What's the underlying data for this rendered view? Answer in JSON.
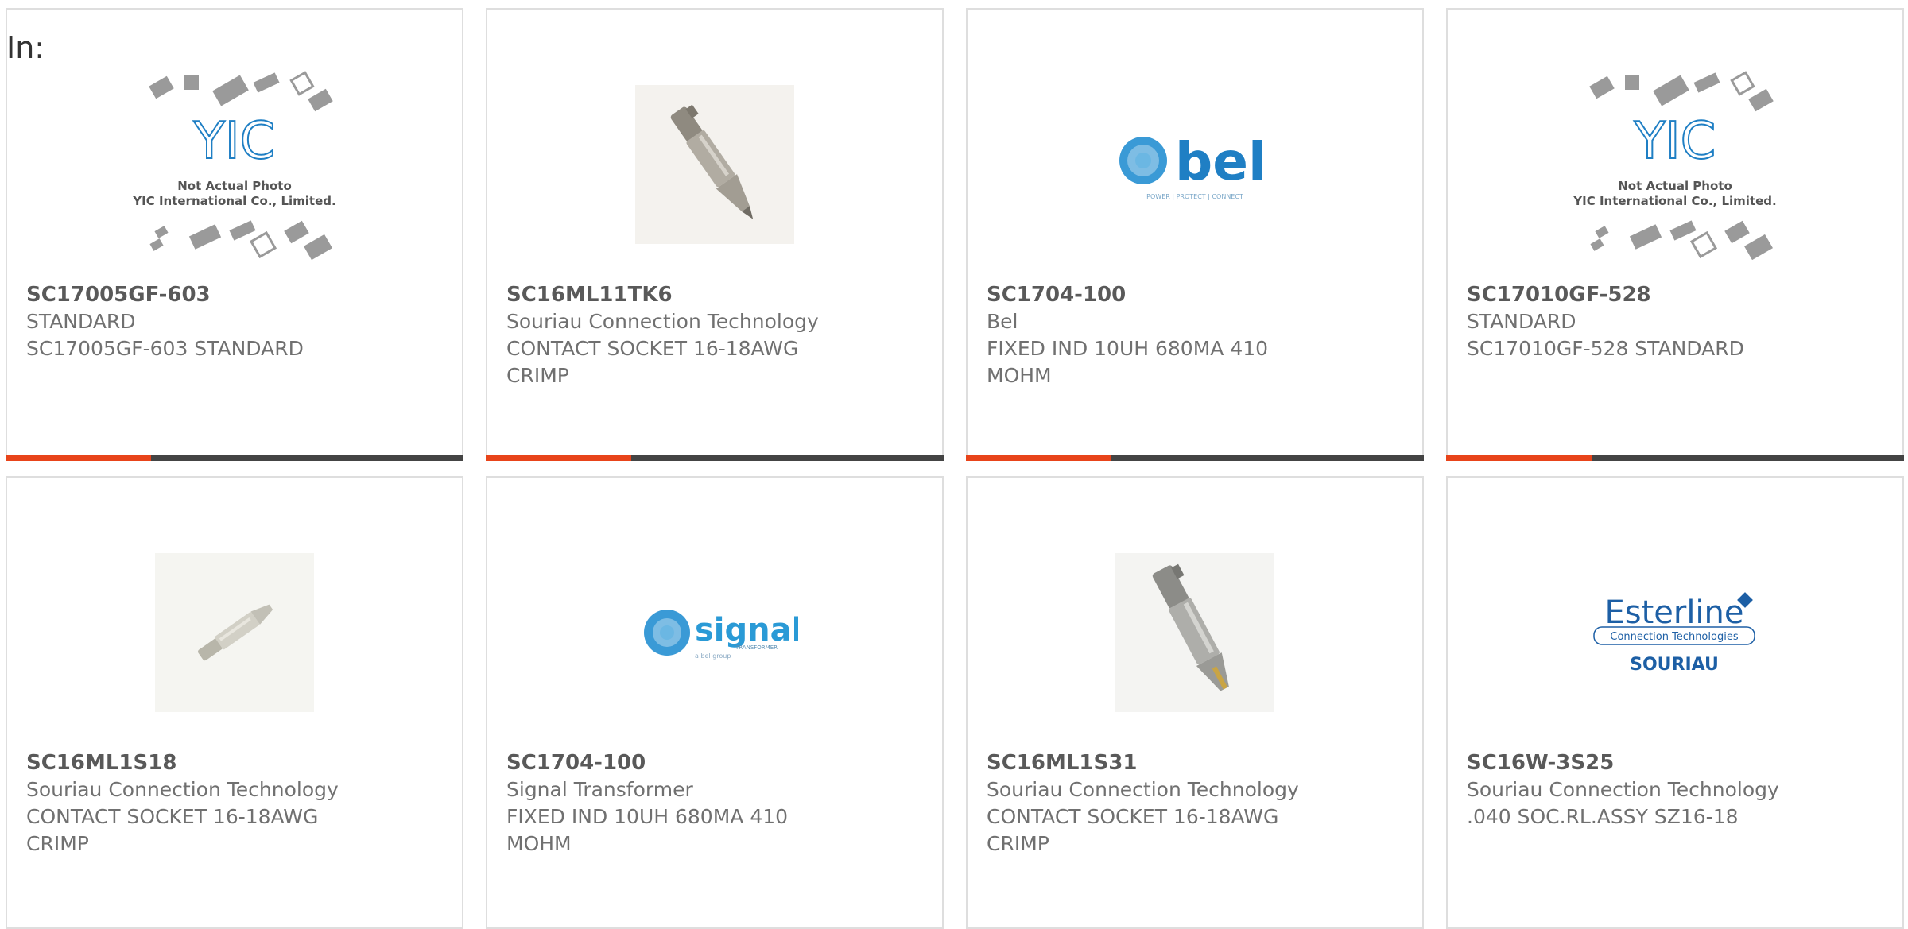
{
  "header": {
    "in_label": "In:"
  },
  "products": [
    {
      "part": "SC17005GF-603",
      "mfr": "STANDARD",
      "desc": "SC17005GF-603 STANDARD",
      "image": "yic-placeholder",
      "photo_caption_1": "Not Actual Photo",
      "photo_caption_2": "YIC International Co., Limited."
    },
    {
      "part": "SC16ML11TK6",
      "mfr": "Souriau Connection Technology",
      "desc": "CONTACT SOCKET 16-18AWG CRIMP",
      "image": "crimp-contact-photo"
    },
    {
      "part": "SC1704-100",
      "mfr": "Bel",
      "desc": "FIXED IND 10UH 680MA 410 MOHM",
      "image": "bel-logo",
      "logo_text": "bel",
      "logo_tagline": "POWER | PROTECT | CONNECT"
    },
    {
      "part": "SC17010GF-528",
      "mfr": "STANDARD",
      "desc": "SC17010GF-528 STANDARD",
      "image": "yic-placeholder",
      "photo_caption_1": "Not Actual Photo",
      "photo_caption_2": "YIC International Co., Limited."
    },
    {
      "part": "SC16ML1S18",
      "mfr": "Souriau Connection Technology",
      "desc": "CONTACT SOCKET 16-18AWG CRIMP",
      "image": "small-contact-photo"
    },
    {
      "part": "SC1704-100",
      "mfr": "Signal Transformer",
      "desc": "FIXED IND 10UH 680MA 410 MOHM",
      "image": "signal-logo",
      "logo_text": "signal",
      "logo_sub": "TRANSFORMER",
      "logo_tagline": "a bel group"
    },
    {
      "part": "SC16ML1S31",
      "mfr": "Souriau Connection Technology",
      "desc": "CONTACT SOCKET 16-18AWG CRIMP",
      "image": "crimp-contact-photo"
    },
    {
      "part": "SC16W-3S25",
      "mfr": "Souriau Connection Technology",
      "desc": ".040 SOC.RL.ASSY SZ16-18",
      "image": "esterline-logo",
      "logo_text": "Esterline",
      "logo_sub": "Connection Technologies",
      "logo_tagline": "SOURIAU"
    }
  ],
  "colors": {
    "accent": "#e8441a",
    "bar": "#444444",
    "bel_blue": "#1f7fc4",
    "signal_blue": "#2a9ad6",
    "esterline_blue": "#1d5fa5"
  }
}
